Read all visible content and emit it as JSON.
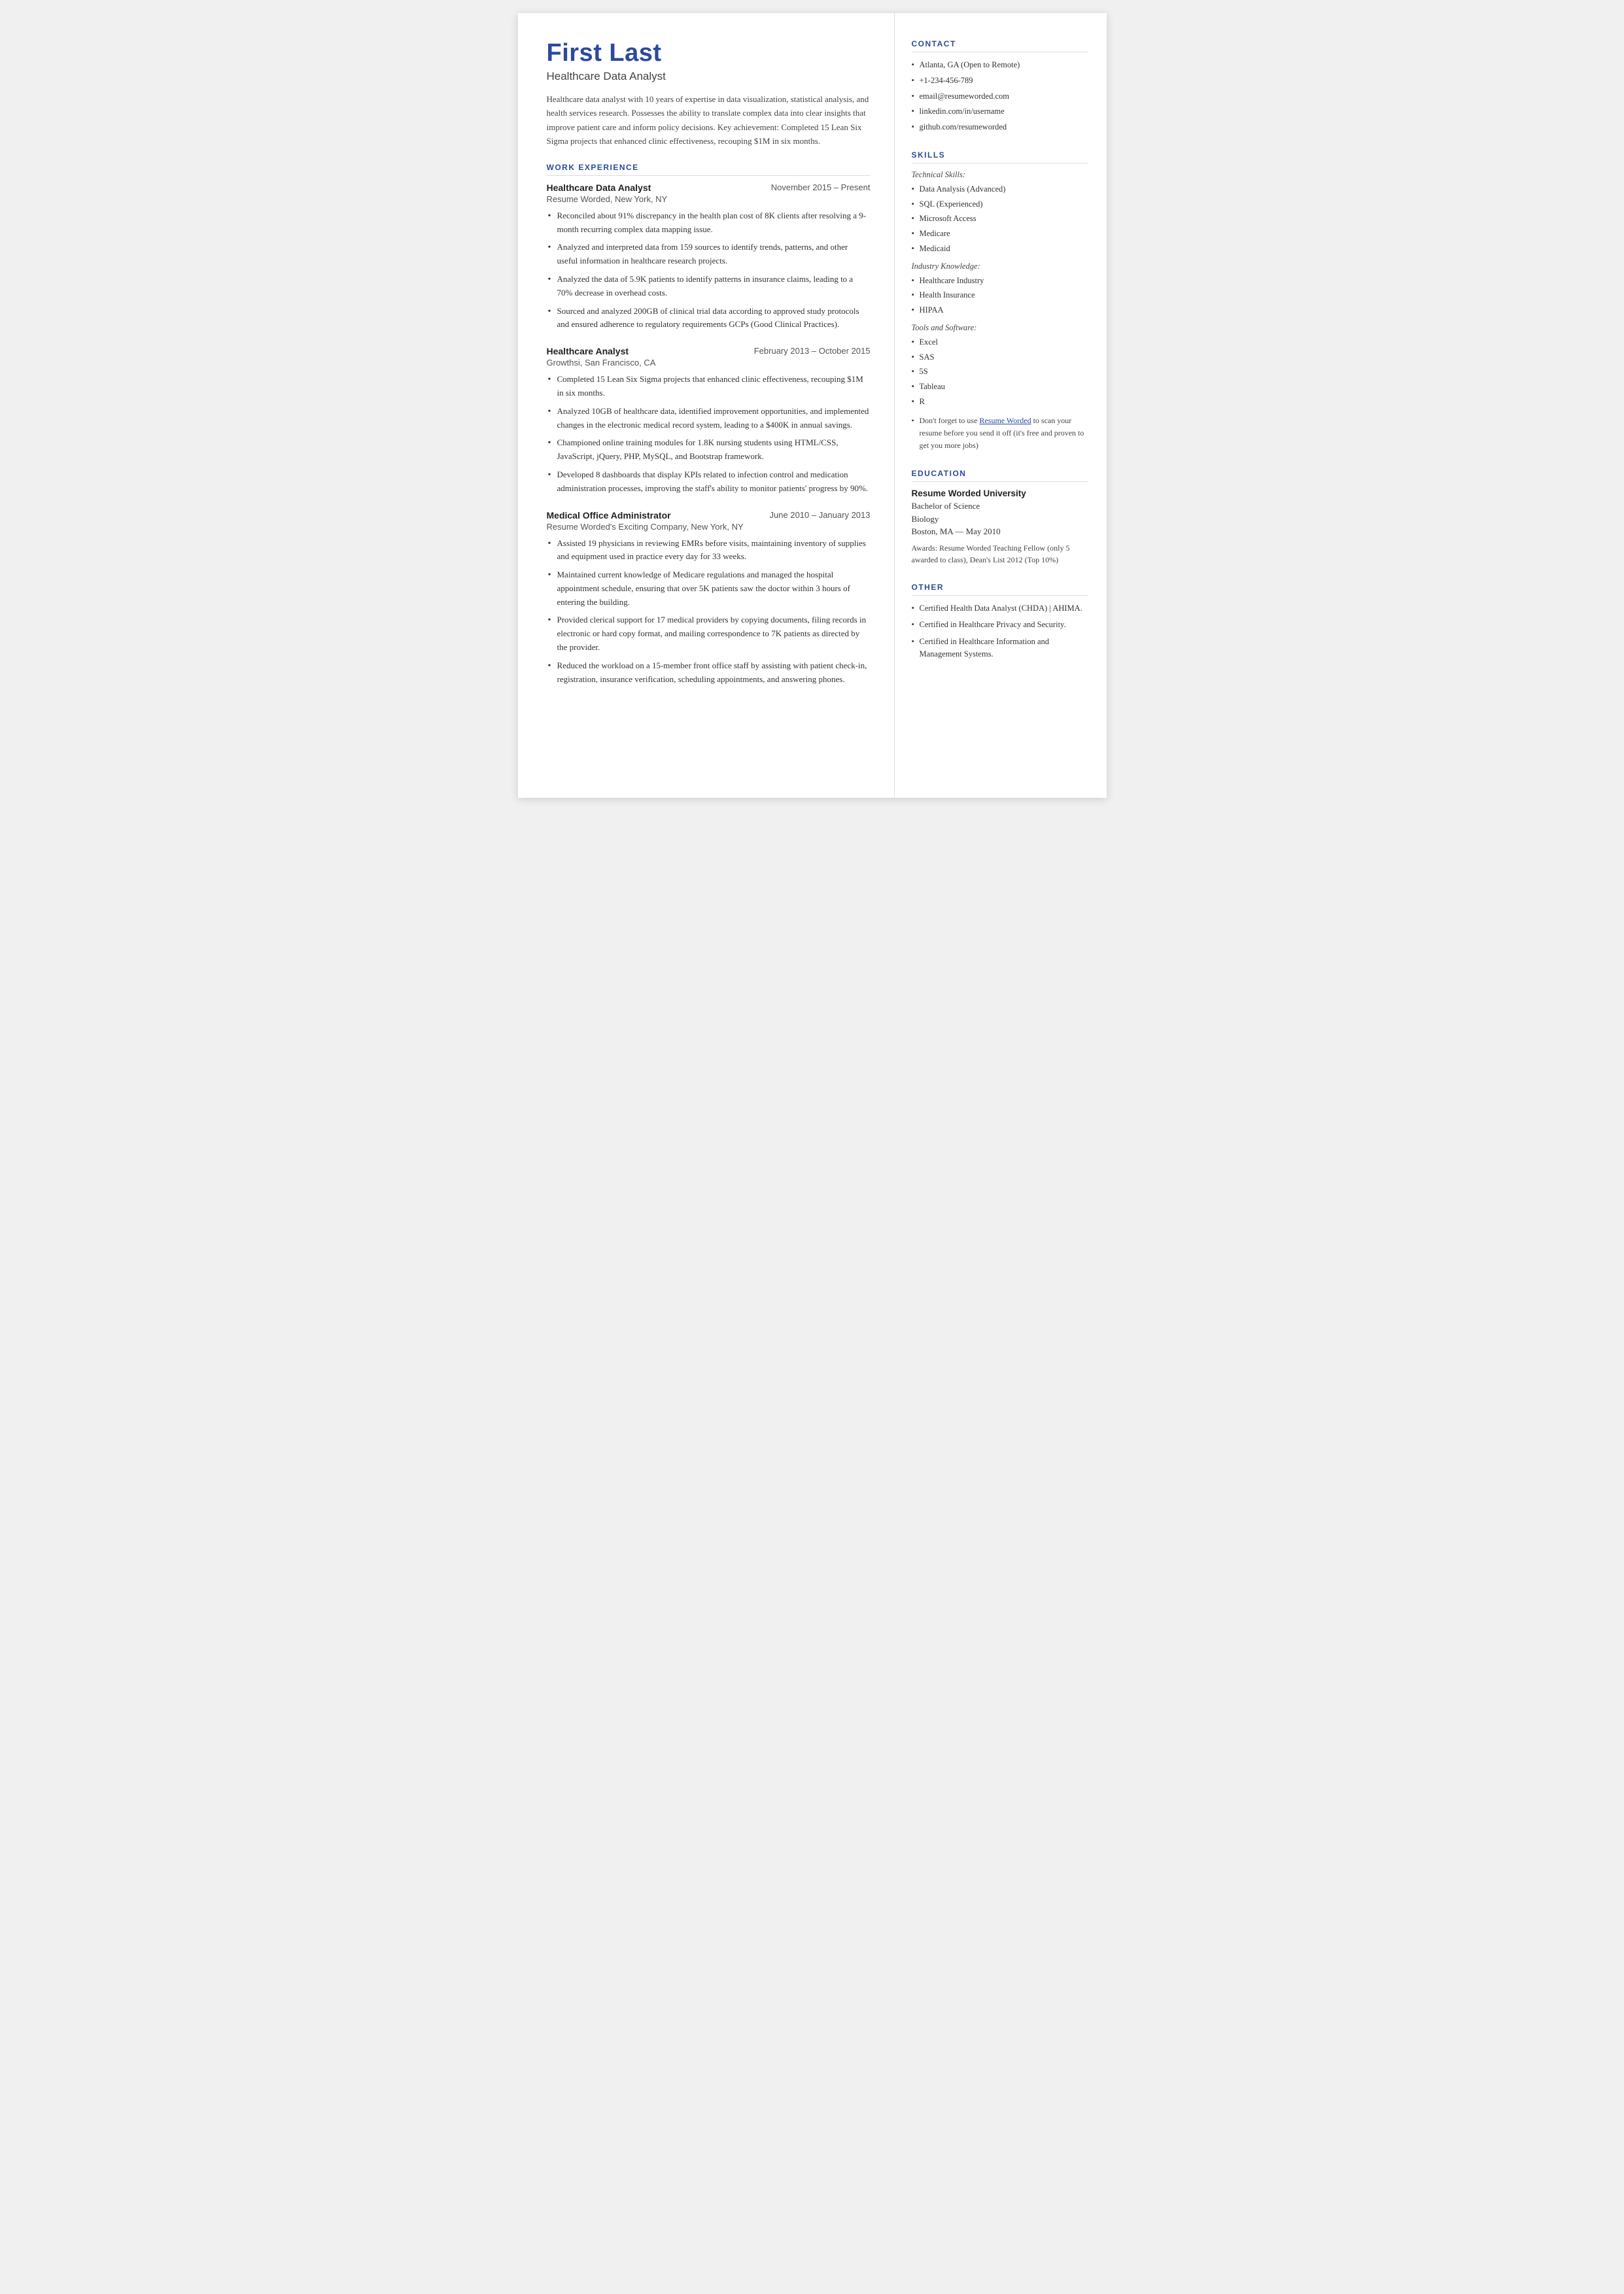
{
  "header": {
    "name": "First Last",
    "title": "Healthcare Data Analyst",
    "summary": "Healthcare data analyst with 10 years of expertise in data visualization, statistical analysis, and health services research. Possesses the ability to translate complex data into clear insights that improve patient care and inform policy decisions. Key achievement: Completed 15 Lean Six Sigma projects that enhanced clinic effectiveness, recouping $1M in six months."
  },
  "work_experience_label": "WORK EXPERIENCE",
  "jobs": [
    {
      "title": "Healthcare Data Analyst",
      "dates": "November 2015 – Present",
      "company": "Resume Worded, New York, NY",
      "bullets": [
        "Reconciled about 91% discrepancy in the health plan cost of 8K clients after resolving a 9-month recurring complex data mapping issue.",
        "Analyzed and interpreted data from 159 sources to identify trends, patterns, and other useful information in healthcare research projects.",
        "Analyzed the data of 5.9K patients to identify patterns in insurance claims, leading to a 70% decrease in overhead costs.",
        "Sourced and analyzed 200GB of clinical trial data according to approved study protocols and ensured adherence to regulatory requirements GCPs (Good Clinical Practices)."
      ]
    },
    {
      "title": "Healthcare Analyst",
      "dates": "February 2013 – October 2015",
      "company": "Growthsi, San Francisco, CA",
      "bullets": [
        "Completed 15 Lean Six Sigma projects that enhanced clinic effectiveness, recouping $1M in six months.",
        "Analyzed 10GB of healthcare data, identified improvement opportunities, and implemented changes in the electronic medical record system, leading to a $400K in annual savings.",
        "Championed online training modules for 1.8K nursing students using HTML/CSS, JavaScript, jQuery, PHP, MySQL, and Bootstrap framework.",
        "Developed 8 dashboards that display KPIs related to infection control and medication administration processes, improving the staff's ability to monitor patients' progress by 90%."
      ]
    },
    {
      "title": "Medical Office Administrator",
      "dates": "June 2010 – January 2013",
      "company": "Resume Worded's Exciting Company, New York, NY",
      "bullets": [
        "Assisted 19 physicians in reviewing EMRs before visits, maintaining inventory of supplies and equipment used in practice every day for 33 weeks.",
        "Maintained current knowledge of Medicare regulations and managed the hospital appointment schedule, ensuring that over 5K patients saw the doctor within 3 hours of entering the building.",
        "Provided clerical support for 17 medical providers by copying documents, filing records in electronic or hard copy format, and mailing correspondence to 7K patients as directed by the provider.",
        "Reduced the workload on a 15-member front office staff by assisting with patient check-in, registration, insurance verification, scheduling appointments, and answering phones."
      ]
    }
  ],
  "contact": {
    "label": "CONTACT",
    "items": [
      "Atlanta, GA (Open to Remote)",
      "+1-234-456-789",
      "email@resumeworded.com",
      "linkedin.com/in/username",
      "github.com/resumeworded"
    ]
  },
  "skills": {
    "label": "SKILLS",
    "technical_label": "Technical Skills:",
    "technical": [
      "Data Analysis (Advanced)",
      "SQL (Experienced)",
      "Microsoft Access",
      "Medicare",
      "Medicaid"
    ],
    "industry_label": "Industry Knowledge:",
    "industry": [
      "Healthcare Industry",
      "Health Insurance",
      "HIPAA"
    ],
    "tools_label": "Tools and Software:",
    "tools": [
      "Excel",
      "SAS",
      "5S",
      "Tableau",
      "R"
    ],
    "tip": "Don't forget to use Resume Worded to scan your resume before you send it off (it's free and proven to get you more jobs)"
  },
  "education": {
    "label": "EDUCATION",
    "school": "Resume Worded University",
    "degree": "Bachelor of Science",
    "field": "Biology",
    "location_date": "Boston, MA — May 2010",
    "awards": "Awards: Resume Worded Teaching Fellow (only 5 awarded to class), Dean's List 2012 (Top 10%)"
  },
  "other": {
    "label": "OTHER",
    "items": [
      "Certified Health Data Analyst (CHDA) | AHIMA.",
      "Certified in Healthcare Privacy and Security.",
      "Certified in Healthcare Information and Management Systems."
    ]
  }
}
